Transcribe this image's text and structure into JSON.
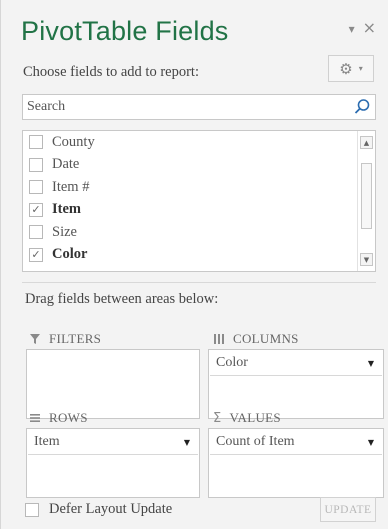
{
  "pane": {
    "title": "PivotTable Fields",
    "title_controls": {
      "dropdown_glyph": "▾",
      "close_glyph": "×"
    },
    "subtitle": "Choose fields to add to report:",
    "tools_button": {
      "icon": "gear-icon",
      "caret": "▾",
      "gear_glyph": "⚙"
    }
  },
  "search": {
    "placeholder": "Search",
    "value": ""
  },
  "fields": [
    {
      "label": "County",
      "checked": false
    },
    {
      "label": "Date",
      "checked": false
    },
    {
      "label": "Item #",
      "checked": false
    },
    {
      "label": "Item",
      "checked": true
    },
    {
      "label": "Size",
      "checked": false
    },
    {
      "label": "Color",
      "checked": true
    }
  ],
  "scrollbar": {
    "up_glyph": "▲",
    "down_glyph": "▼"
  },
  "areas_label": "Drag fields between areas below:",
  "areas": {
    "filters": {
      "label": "FILTERS",
      "icon": "filter-icon",
      "value": ""
    },
    "columns": {
      "label": "COLUMNS",
      "icon": "columns-icon",
      "value": "Color"
    },
    "rows": {
      "label": "ROWS",
      "icon": "rows-icon",
      "value": "Item"
    },
    "values": {
      "label": "VALUES",
      "icon": "sigma-icon",
      "sigma_glyph": "Σ",
      "value": "Count of Item"
    }
  },
  "dropdown_glyph": "▼",
  "defer": {
    "label": "Defer Layout Update",
    "checked": false
  },
  "update_button": {
    "label": "UPDATE"
  },
  "colors": {
    "title": "#217346",
    "search_icon": "#2b6cb0"
  }
}
